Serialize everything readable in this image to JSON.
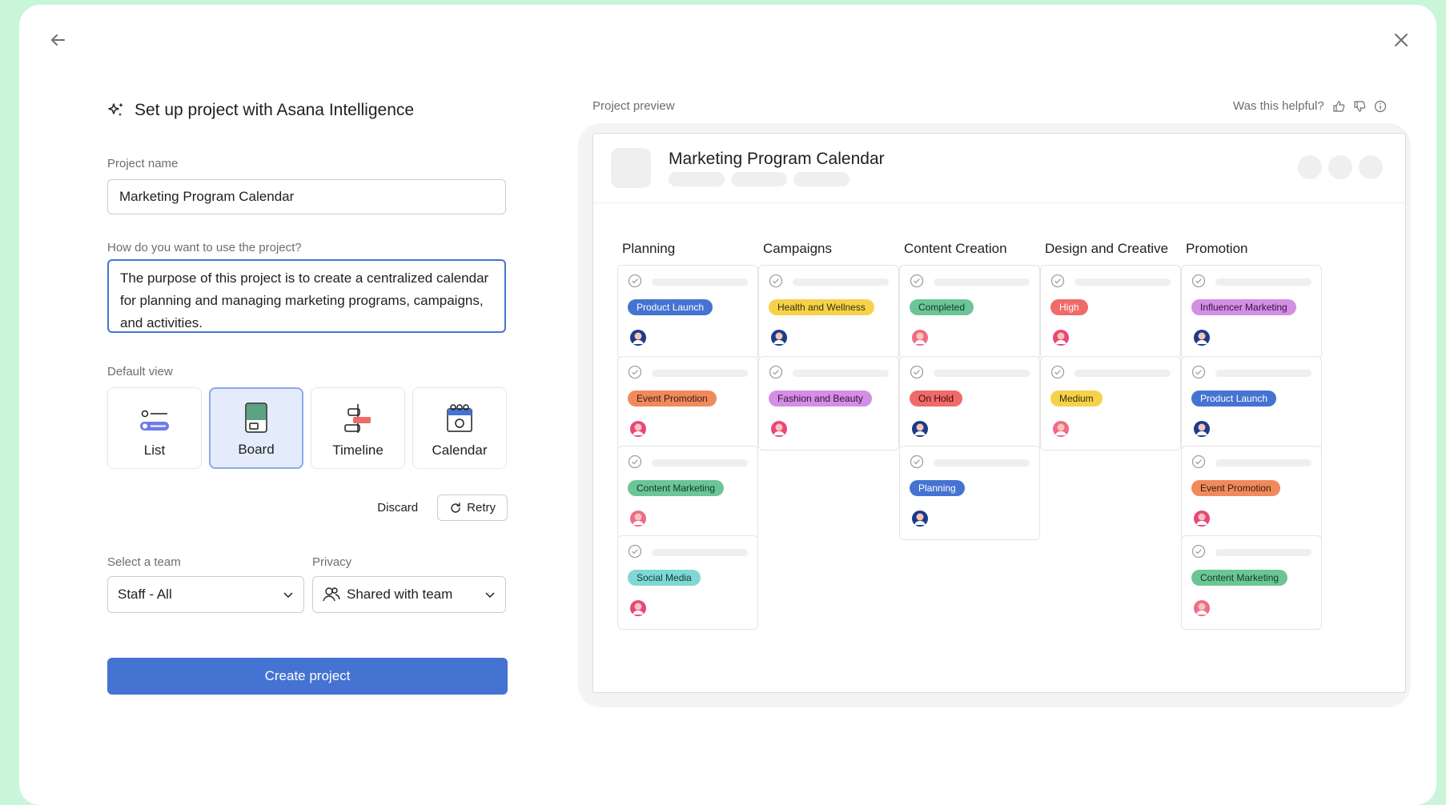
{
  "setup": {
    "heading": "Set up project with Asana Intelligence",
    "project_name_label": "Project name",
    "project_name_value": "Marketing Program Calendar",
    "use_label": "How do you want to use the project?",
    "use_value": "The purpose of this project is to create a centralized calendar for planning and managing marketing programs, campaigns, and activities.",
    "default_view_label": "Default view",
    "views": [
      {
        "label": "List",
        "icon": "list-icon"
      },
      {
        "label": "Board",
        "icon": "board-icon",
        "selected": true
      },
      {
        "label": "Timeline",
        "icon": "timeline-icon"
      },
      {
        "label": "Calendar",
        "icon": "calendar-icon"
      }
    ],
    "discard_label": "Discard",
    "retry_label": "Retry",
    "team_label": "Select a team",
    "team_value": "Staff - All",
    "privacy_label": "Privacy",
    "privacy_value": "Shared with team",
    "create_label": "Create project"
  },
  "preview": {
    "label": "Project preview",
    "helpful_text": "Was this helpful?",
    "title": "Marketing Program Calendar",
    "columns": [
      {
        "title": "Planning",
        "cards": [
          {
            "tag": "Product Launch",
            "color": "#4573d2",
            "text": "#ffffff",
            "avatar": "#1b3a8a"
          },
          {
            "tag": "Event Promotion",
            "color": "#f08a5d",
            "text": "#3a1a0c",
            "avatar": "#e8477a"
          },
          {
            "tag": "Content Marketing",
            "color": "#6bc596",
            "text": "#0f3a24",
            "avatar": "#f06a8a"
          },
          {
            "tag": "Social Media",
            "color": "#7fd8d4",
            "text": "#0d3a38",
            "avatar": "#e8477a"
          }
        ]
      },
      {
        "title": "Campaigns",
        "cards": [
          {
            "tag": "Health and Wellness",
            "color": "#f6d24b",
            "text": "#3a2e05",
            "avatar": "#1b3a8a"
          },
          {
            "tag": "Fashion and Beauty",
            "color": "#d38fe3",
            "text": "#3a0f45",
            "avatar": "#e8477a"
          }
        ]
      },
      {
        "title": "Content Creation",
        "cards": [
          {
            "tag": "Completed",
            "color": "#6bc596",
            "text": "#0f3a24",
            "avatar": "#f06a8a"
          },
          {
            "tag": "On Hold",
            "color": "#f06a6a",
            "text": "#3a0c0c",
            "avatar": "#1b3a8a"
          },
          {
            "tag": "Planning",
            "color": "#4573d2",
            "text": "#ffffff",
            "avatar": "#1b3a8a"
          }
        ]
      },
      {
        "title": "Design and Creative",
        "cards": [
          {
            "tag": "High",
            "color": "#f06a6a",
            "text": "#ffffff",
            "avatar": "#e8477a"
          },
          {
            "tag": "Medium",
            "color": "#f6d24b",
            "text": "#3a2e05",
            "avatar": "#f06a8a"
          }
        ]
      },
      {
        "title": "Promotion",
        "cards": [
          {
            "tag": "Influencer Marketing",
            "color": "#d38fe3",
            "text": "#3a0f45",
            "avatar": "#1b3a8a"
          },
          {
            "tag": "Product Launch",
            "color": "#4573d2",
            "text": "#ffffff",
            "avatar": "#1b3a8a"
          },
          {
            "tag": "Event Promotion",
            "color": "#f08a5d",
            "text": "#3a1a0c",
            "avatar": "#e8477a"
          },
          {
            "tag": "Content Marketing",
            "color": "#6bc596",
            "text": "#0f3a24",
            "avatar": "#f06a8a"
          }
        ]
      }
    ]
  },
  "colors": {
    "accent": "#4573d2",
    "backdrop": "#c9f5d9"
  }
}
